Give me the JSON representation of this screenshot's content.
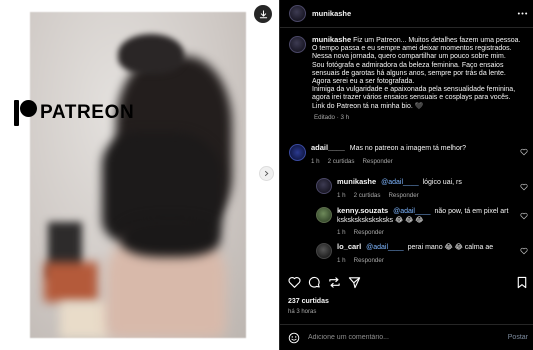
{
  "media": {
    "brand_text": "PATREON"
  },
  "post": {
    "username": "munikashe",
    "caption": [
      "Fiz um Patreon... Muitos detalhes fazem uma pessoa.",
      "O tempo passa e eu sempre amei deixar momentos registrados.",
      "Nessa nova jornada, quero compartilhar um pouco sobre mim.",
      "Sou fotógrafa e admiradora da beleza feminina. Faço ensaios",
      "sensuais de garotas há alguns anos, sempre por trás da lente.",
      "Agora serei eu a ser fotografada.",
      "Inimiga da vulgaridade e apaixonada pela sensualidade feminina,",
      "agora irei trazer vários ensaios sensuais e cosplays para vocês.",
      "Link do Patreon tá na minha bio. 🖤"
    ],
    "edited": "Editado · 3 h",
    "likes": "237 curtidas",
    "date": "há 3 horas"
  },
  "comments": [
    {
      "user": "adail____",
      "text": "Mas no patreon a imagem tá melhor?",
      "time": "1 h",
      "likes": "2 curtidas",
      "reply_label": "Responder"
    },
    {
      "user": "munikashe",
      "mention": "@adail____",
      "text": "lógico uai, rs",
      "time": "1 h",
      "likes": "2 curtidas",
      "reply_label": "Responder"
    },
    {
      "user": "kenny.souzats",
      "mention": "@adail____",
      "text": "não pow, tá em pixel art",
      "text2": "ksksksksksksksks 😂 😂 😂",
      "time": "1 h",
      "reply_label": "Responder"
    },
    {
      "user": "lo_carl",
      "mention": "@adail____",
      "text": "perai mano 😂 😂 calma ae",
      "time": "1 h",
      "reply_label": "Responder"
    }
  ],
  "composer": {
    "placeholder": "Adicione um comentário...",
    "post_label": "Postar"
  },
  "colors": {
    "background": "#000000",
    "link": "#7fb6ff",
    "muted": "#a8a8a8"
  }
}
